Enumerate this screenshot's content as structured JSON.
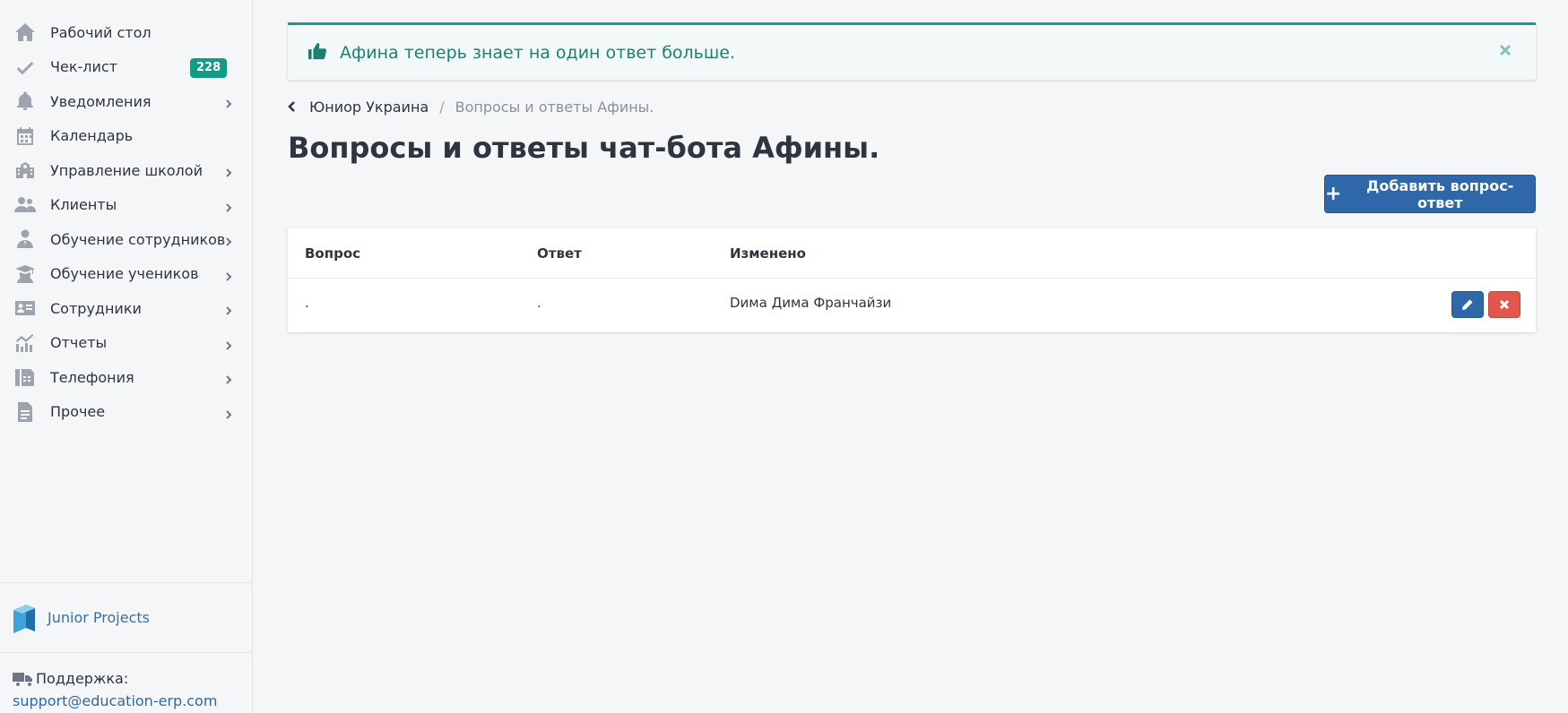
{
  "sidebar": {
    "items": [
      {
        "label": "Рабочий стол",
        "icon": "home-icon"
      },
      {
        "label": "Чек-лист",
        "icon": "check-icon",
        "badge": "228"
      },
      {
        "label": "Уведомления",
        "icon": "bell-icon"
      },
      {
        "label": "Календарь",
        "icon": "calendar-icon"
      },
      {
        "label": "Управление школой",
        "icon": "school-icon"
      },
      {
        "label": "Клиенты",
        "icon": "users-icon"
      },
      {
        "label": "Обучение сотрудников",
        "icon": "staff-training-icon"
      },
      {
        "label": "Обучение учеников",
        "icon": "graduation-cap-icon"
      },
      {
        "label": "Сотрудники",
        "icon": "id-card-icon"
      },
      {
        "label": "Отчеты",
        "icon": "chart-icon"
      },
      {
        "label": "Телефония",
        "icon": "fax-icon"
      },
      {
        "label": "Прочее",
        "icon": "document-icon"
      }
    ],
    "brand": "Junior Projects",
    "support_label": "Поддержка:",
    "support_email": "support@education-erp.com"
  },
  "alert": {
    "text": "Афина теперь знает на один ответ больше.",
    "icon": "thumbs-up-icon",
    "color": "#1d7f72"
  },
  "breadcrumb": {
    "parent": "Юниор Украина",
    "separator": "/",
    "current": "Вопросы и ответы Афины."
  },
  "page": {
    "title": "Вопросы и ответы чат-бота Афины.",
    "add_button": "Добавить вопрос-ответ"
  },
  "table": {
    "columns": [
      "Вопрос",
      "Ответ",
      "Изменено"
    ],
    "rows": [
      {
        "question": ".",
        "answer": ".",
        "modified": "Dима Дима Франчайзи"
      }
    ]
  },
  "colors": {
    "primary": "#2f68a8",
    "success": "#139b86",
    "danger": "#e2574c"
  }
}
